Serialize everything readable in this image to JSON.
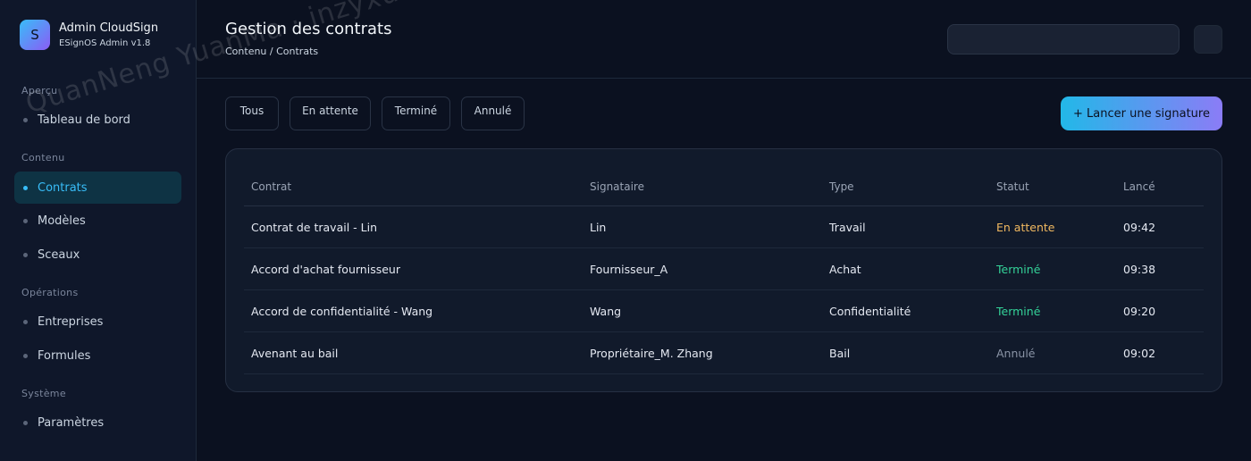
{
  "brand": {
    "logo_letter": "S",
    "title": "Admin CloudSign",
    "subtitle": "ESignOS Admin v1.8"
  },
  "sidebar": {
    "sections": [
      {
        "title": "Aperçu",
        "items": [
          {
            "label": "Tableau de bord"
          }
        ]
      },
      {
        "title": "Contenu",
        "items": [
          {
            "label": "Contrats",
            "active": true
          },
          {
            "label": "Modèles"
          },
          {
            "label": "Sceaux"
          }
        ]
      },
      {
        "title": "Opérations",
        "items": [
          {
            "label": "Entreprises"
          },
          {
            "label": "Formules"
          }
        ]
      },
      {
        "title": "Système",
        "items": [
          {
            "label": "Paramètres"
          }
        ]
      }
    ]
  },
  "header": {
    "title": "Gestion des contrats",
    "breadcrumb": "Contenu / Contrats",
    "search_value": ""
  },
  "filters": [
    {
      "label": "Tous"
    },
    {
      "label": "En attente"
    },
    {
      "label": "Terminé"
    },
    {
      "label": "Annulé"
    }
  ],
  "primary_action": {
    "label": "+ Lancer une signature"
  },
  "table": {
    "columns": [
      "Contrat",
      "Signataire",
      "Type",
      "Statut",
      "Lancé"
    ],
    "rows": [
      {
        "contract": "Contrat de travail - Lin",
        "signer": "Lin",
        "type": "Travail",
        "status": "En attente",
        "status_kind": "wait",
        "launched": "09:42"
      },
      {
        "contract": "Accord d'achat fournisseur",
        "signer": "Fournisseur_A",
        "type": "Achat",
        "status": "Terminé",
        "status_kind": "done",
        "launched": "09:38"
      },
      {
        "contract": "Accord de confidentialité - Wang",
        "signer": "Wang",
        "type": "Confidentialité",
        "status": "Terminé",
        "status_kind": "done",
        "launched": "09:20"
      },
      {
        "contract": "Avenant au bail",
        "signer": "Propriétaire_M. Zhang",
        "type": "Bail",
        "status": "Annulé",
        "status_kind": "cancel",
        "launched": "09:02"
      }
    ]
  },
  "colors": {
    "accent": "#38bdf8",
    "wait": "#f0b860",
    "done": "#34d399",
    "cancel": "#8a94a6"
  },
  "watermark": "QuanNeng YuanMa · inzyxuashop.com"
}
